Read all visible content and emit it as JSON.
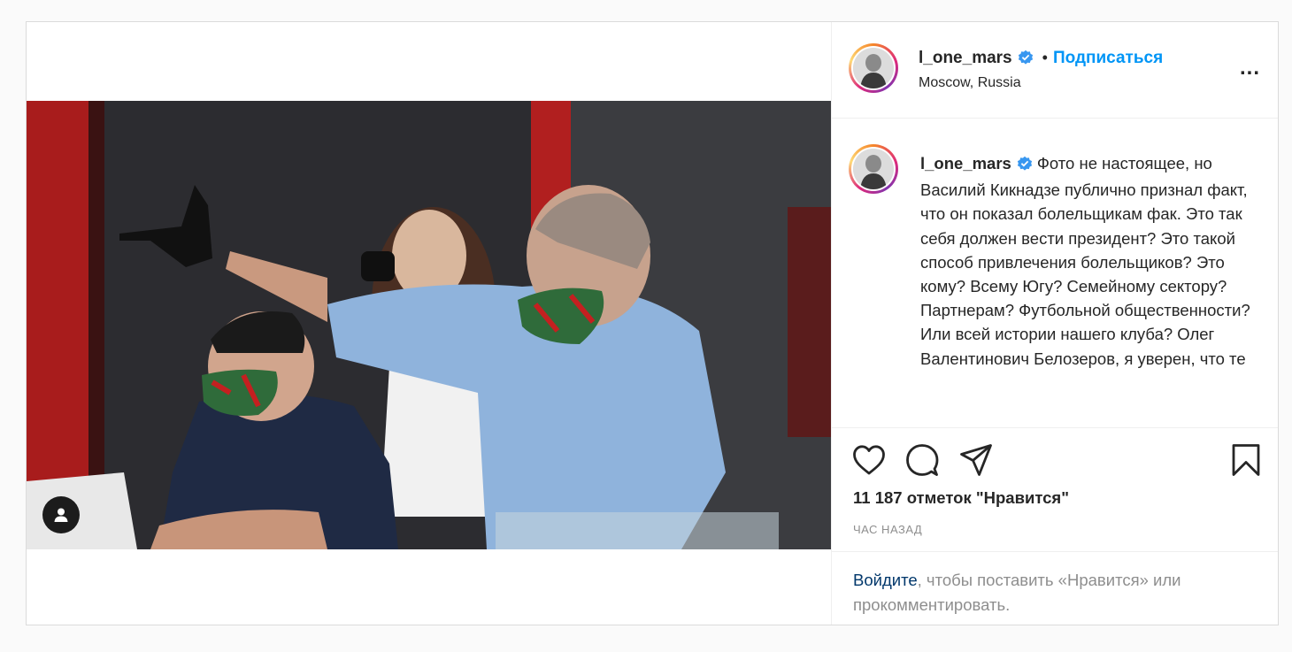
{
  "post": {
    "username": "l_one_mars",
    "follow_label": "Подписаться",
    "separator": "•",
    "location": "Moscow, Russia",
    "more_label": "...",
    "caption": "Фото не настоящее, но Василий Кикнадзе публично признал факт, что он показал болельщикам фак. Это так себя должен вести президент? Это такой способ привлечения болельщиков? Это кому? Всему Югу? Семейному сектору? Партнерам? Футбольной общественности? Или всей истории нашего клуба? Олег Валентинович Белозеров, я уверен, что те",
    "likes": "11 187 отметок \"Нравится\"",
    "time": "час назад",
    "login_link": "Войдите",
    "login_rest": ", чтобы поставить «Нравится» или прокомментировать."
  },
  "icons": {
    "verified": "verified-badge-icon",
    "like": "heart-icon",
    "comment": "comment-bubble-icon",
    "share": "paper-plane-icon",
    "save": "bookmark-icon",
    "tag": "user-tag-icon"
  },
  "colors": {
    "link_blue": "#0095f6",
    "login_link": "#00376b",
    "muted_text": "#8e8e8e",
    "border": "#dbdbdb",
    "page_bg": "#fafafa"
  }
}
